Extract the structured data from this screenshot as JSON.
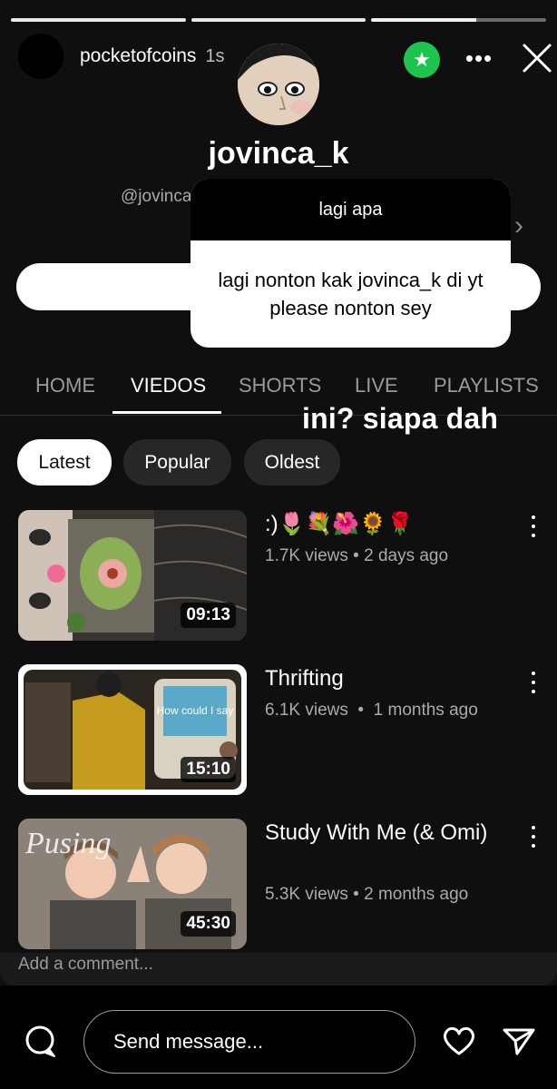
{
  "story": {
    "progress": [
      1,
      1,
      0.6
    ],
    "username": "pocketofcoins",
    "time": "1s",
    "star_icon": "star-icon",
    "more_icon": "more-dots-icon",
    "close_icon": "close-icon"
  },
  "channel": {
    "name": "jovinca_k",
    "handle": "@jovinca"
  },
  "question": {
    "prompt": "lagi apa",
    "answer": "lagi nonton kak jovinca_k di yt please nonton sey"
  },
  "tabs": [
    "HOME",
    "VIEDOS",
    "SHORTS",
    "LIVE",
    "PLAYLISTS"
  ],
  "active_tab": "VIEDOS",
  "caption": "ini? siapa dah",
  "chips": [
    "Latest",
    "Popular",
    "Oldest"
  ],
  "active_chip": "Latest",
  "videos": [
    {
      "title": ":)🌷💐🌺🌻🌹",
      "views": "1.7K views",
      "age": "2 days ago",
      "duration": "09:13"
    },
    {
      "title": "Thrifting",
      "views": "6.1K views",
      "age": "1 months ago",
      "duration": "15:10"
    },
    {
      "title": "Study With Me (& Omi)",
      "views": "5.3K views",
      "age": "2 months ago",
      "duration": "45:30"
    }
  ],
  "comment_placeholder": "Add a comment...",
  "message_placeholder": "Send message...",
  "colors": {
    "background": "#0f0f0f",
    "star_badge": "#1fc44e",
    "chip_inactive": "#272727",
    "muted_text": "#aaaaaa"
  }
}
